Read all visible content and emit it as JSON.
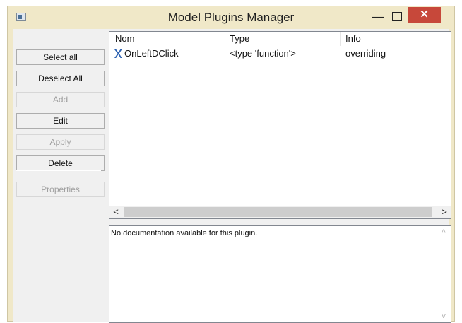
{
  "window": {
    "title": "Model Plugins Manager",
    "minimize_symbol": "—",
    "close_symbol": "✕"
  },
  "buttons": {
    "select_all": "Select all",
    "deselect_all": "Deselect All",
    "add": "Add",
    "edit": "Edit",
    "apply": "Apply",
    "delete": "Delete",
    "properties": "Properties"
  },
  "plugin_list": {
    "columns": [
      "Nom",
      "Type",
      "Info"
    ],
    "rows": [
      {
        "nom": "OnLeftDClick",
        "type": "<type 'function'>",
        "info": "overriding"
      }
    ],
    "scroll_left": "<",
    "scroll_right": ">"
  },
  "documentation": {
    "text": "No documentation available for this plugin.",
    "scroll_up": "^",
    "scroll_down": "v"
  },
  "icons": {
    "app": "app-window-icon",
    "plugin_row": "blue-x-icon"
  },
  "colors": {
    "frame": "#f0e8c8",
    "close_button": "#c7483a",
    "row_icon": "#2a5fb0"
  }
}
